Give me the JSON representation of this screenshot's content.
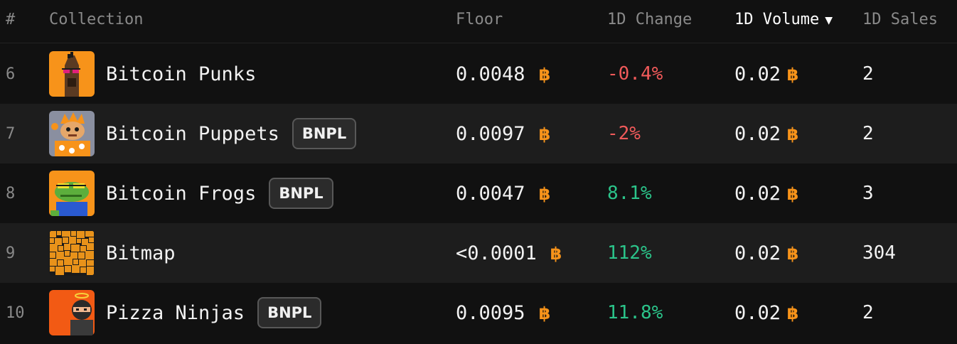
{
  "header": {
    "rank": "#",
    "collection": "Collection",
    "floor": "Floor",
    "change": "1D Change",
    "volume": "1D Volume",
    "sales": "1D Sales",
    "sort_indicator": "▼"
  },
  "rows": [
    {
      "rank": "6",
      "name": "Bitcoin Punks",
      "badge": "",
      "floor": "0.0048",
      "change": "-0.4%",
      "volume": "0.02",
      "sales": "2",
      "icon": "bitcoin-punks-thumbnail"
    },
    {
      "rank": "7",
      "name": "Bitcoin Puppets",
      "badge": "BNPL",
      "floor": "0.0097",
      "change": "-2%",
      "volume": "0.02",
      "sales": "2",
      "icon": "bitcoin-puppets-thumbnail"
    },
    {
      "rank": "8",
      "name": "Bitcoin Frogs",
      "badge": "BNPL",
      "floor": "0.0047",
      "change": "8.1%",
      "volume": "0.02",
      "sales": "3",
      "icon": "bitcoin-frogs-thumbnail"
    },
    {
      "rank": "9",
      "name": "Bitmap",
      "badge": "",
      "floor": "<0.0001",
      "change": "112%",
      "volume": "0.02",
      "sales": "304",
      "icon": "bitmap-thumbnail"
    },
    {
      "rank": "10",
      "name": "Pizza Ninjas",
      "badge": "BNPL",
      "floor": "0.0095",
      "change": "11.8%",
      "volume": "0.02",
      "sales": "2",
      "icon": "pizza-ninjas-thumbnail"
    }
  ],
  "colors": {
    "background": "#111111",
    "row_alt": "#1d1d1d",
    "negative": "#f05a5a",
    "positive": "#2bc48a",
    "btc_orange": "#f7931a"
  }
}
